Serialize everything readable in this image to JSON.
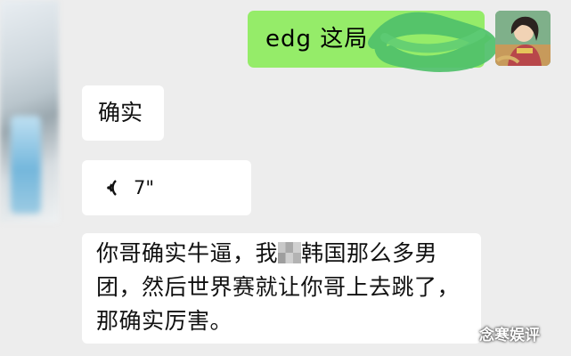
{
  "messages": [
    {
      "sender": "self",
      "text": "edg 这局",
      "type": "text"
    },
    {
      "sender": "other",
      "text": "确实",
      "type": "text"
    },
    {
      "sender": "other",
      "type": "voice",
      "duration": "7\""
    },
    {
      "sender": "other",
      "type": "text",
      "lines": [
        {
          "before_mosaic": "你哥确实牛逼，我",
          "after_mosaic": "韩国那么多男"
        },
        "团，然后世界赛就让你哥上去跳了，",
        "那确实厉害。"
      ]
    }
  ],
  "icons": {
    "voice": "voice-wave-icon",
    "avatar_self": "avatar",
    "avatar_other": "avatar"
  },
  "colors": {
    "background": "#ededed",
    "sent_bubble": "#95ec69",
    "received_bubble": "#ffffff",
    "scribble": "#4fc06a"
  },
  "watermark": "念寒娱评"
}
